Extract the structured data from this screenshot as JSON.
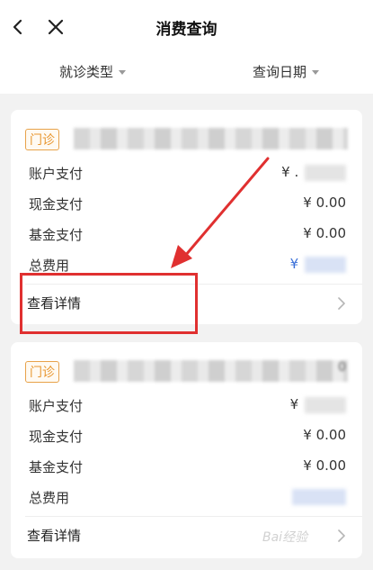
{
  "header": {
    "title": "消费查询",
    "back_icon": "chevron-left-icon",
    "close_icon": "close-icon"
  },
  "filters": {
    "visit_type": "就诊类型",
    "query_date": "查询日期"
  },
  "records": [
    {
      "badge": "门诊",
      "hospital_name": "",
      "rows": [
        {
          "label": "账户支付",
          "currency": "¥",
          "amount": ".",
          "blurred": true
        },
        {
          "label": "现金支付",
          "currency": "",
          "amount": "¥ 0.00",
          "blurred": false
        },
        {
          "label": "基金支付",
          "currency": "",
          "amount": "¥ 0.00",
          "blurred": false
        },
        {
          "label": "总费用",
          "currency": "¥",
          "amount": "",
          "blurred": true
        }
      ],
      "detail_label": "查看详情"
    },
    {
      "badge": "门诊",
      "hospital_name": "0",
      "rows": [
        {
          "label": "账户支付",
          "currency": "¥",
          "amount": "",
          "blurred": true
        },
        {
          "label": "现金支付",
          "currency": "",
          "amount": "¥ 0.00",
          "blurred": false
        },
        {
          "label": "基金支付",
          "currency": "",
          "amount": "¥ 0.00",
          "blurred": false
        },
        {
          "label": "总费用",
          "currency": "",
          "amount": "",
          "blurred": true
        }
      ],
      "detail_label": "查看详情"
    }
  ],
  "annotation": {
    "color": "#e03030"
  },
  "colors": {
    "badge": "#e8962e",
    "total_currency": "#3a6fd8"
  },
  "watermark": "Bai经验"
}
